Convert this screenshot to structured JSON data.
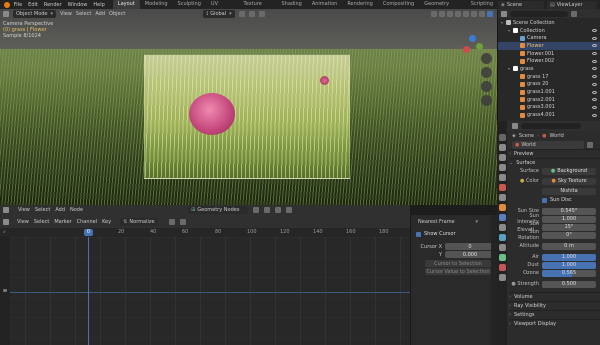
{
  "topbar": {
    "menus": [
      "File",
      "Edit",
      "Render",
      "Window",
      "Help"
    ],
    "workspaces": [
      "Layout",
      "Modeling",
      "Sculpting",
      "UV Editing",
      "Texture Paint",
      "Shading",
      "Animation",
      "Rendering",
      "Compositing",
      "Geometry Nodes",
      "Scripting"
    ],
    "active_workspace": "Layout",
    "scene_label": "Scene",
    "viewlayer_label": "ViewLayer"
  },
  "viewport": {
    "mode": "Object Mode",
    "menus": [
      "View",
      "Select",
      "Add",
      "Object"
    ],
    "transform": "Global",
    "info_line1": "Camera Perspective",
    "info_line2": "(0) grass | Flower",
    "info_line3": "Sample 8/1024",
    "colors": {
      "grass_light": "#c6cc9a",
      "flower": "#d05a8a"
    }
  },
  "node_editor": {
    "menus": [
      "View",
      "Select",
      "Add",
      "Node"
    ],
    "tree_label": "Geometry Nodes"
  },
  "timeline": {
    "menus": [
      "View",
      "Select",
      "Marker",
      "Channel",
      "Key"
    ],
    "normalize_label": "Normalize",
    "current_frame_badge": "0",
    "ruler_ticks": [
      "20",
      "40",
      "60",
      "80",
      "100",
      "120",
      "140",
      "160",
      "180"
    ],
    "panel": {
      "dropdown": "Nearest Frame",
      "show_cursor_label": "Show Cursor",
      "cursor_x_label": "Cursor X",
      "cursor_x_value": "0",
      "cursor_y_label": "Y",
      "cursor_y_value": "0.000",
      "cursor_to_selection": "Cursor to Selection",
      "cursor_value_to_selection": "Cursor Value to Selection"
    }
  },
  "outliner": {
    "rows": [
      {
        "label": "Scene Collection",
        "indent": 0,
        "color": "#bbbbbb"
      },
      {
        "label": "Collection",
        "indent": 1,
        "color": "#ffffff"
      },
      {
        "label": "Camera",
        "indent": 2,
        "color": "#6aa0d0"
      },
      {
        "label": "Flower",
        "indent": 2,
        "color": "#e08c3a"
      },
      {
        "label": "Flower.001",
        "indent": 2,
        "color": "#e08c3a"
      },
      {
        "label": "Flower.002",
        "indent": 2,
        "color": "#e08c3a"
      },
      {
        "label": "grass",
        "indent": 1,
        "color": "#ffffff"
      },
      {
        "label": "grass 17",
        "indent": 2,
        "color": "#e08c3a"
      },
      {
        "label": "grass 20",
        "indent": 2,
        "color": "#e08c3a"
      },
      {
        "label": "grass1.001",
        "indent": 2,
        "color": "#e08c3a"
      },
      {
        "label": "grass2.001",
        "indent": 2,
        "color": "#e08c3a"
      },
      {
        "label": "grass3.001",
        "indent": 2,
        "color": "#e08c3a"
      },
      {
        "label": "grass4.001",
        "indent": 2,
        "color": "#e08c3a"
      }
    ]
  },
  "properties": {
    "breadcrumb_scene": "Scene",
    "breadcrumb_world": "World",
    "world_name": "World",
    "sections": {
      "preview": "Preview",
      "surface": "Surface",
      "volume": "Volume",
      "ray_visibility": "Ray Visibility",
      "settings": "Settings",
      "viewport_display": "Viewport Display"
    },
    "surface_label": "Surface",
    "surface_value": "Background",
    "color_label": "Color",
    "color_value": "Sky Texture",
    "sky_type": "Nishita",
    "sun_disc_label": "Sun Disc",
    "fields": [
      {
        "label": "Sun Size",
        "value": "0.545°"
      },
      {
        "label": "Sun Intensity",
        "value": "1.000"
      },
      {
        "label": "Sun Elevati...",
        "value": "15°"
      },
      {
        "label": "Sun Rotation",
        "value": "0°"
      },
      {
        "label": "Altitude",
        "value": "0 m"
      }
    ],
    "air_label": "Air",
    "air_value": "1.000",
    "dust_label": "Dust",
    "dust_value": "1.000",
    "ozone_label": "Ozone",
    "ozone_value": "0.565",
    "strength_label": "Strength",
    "strength_value": "0.500"
  }
}
